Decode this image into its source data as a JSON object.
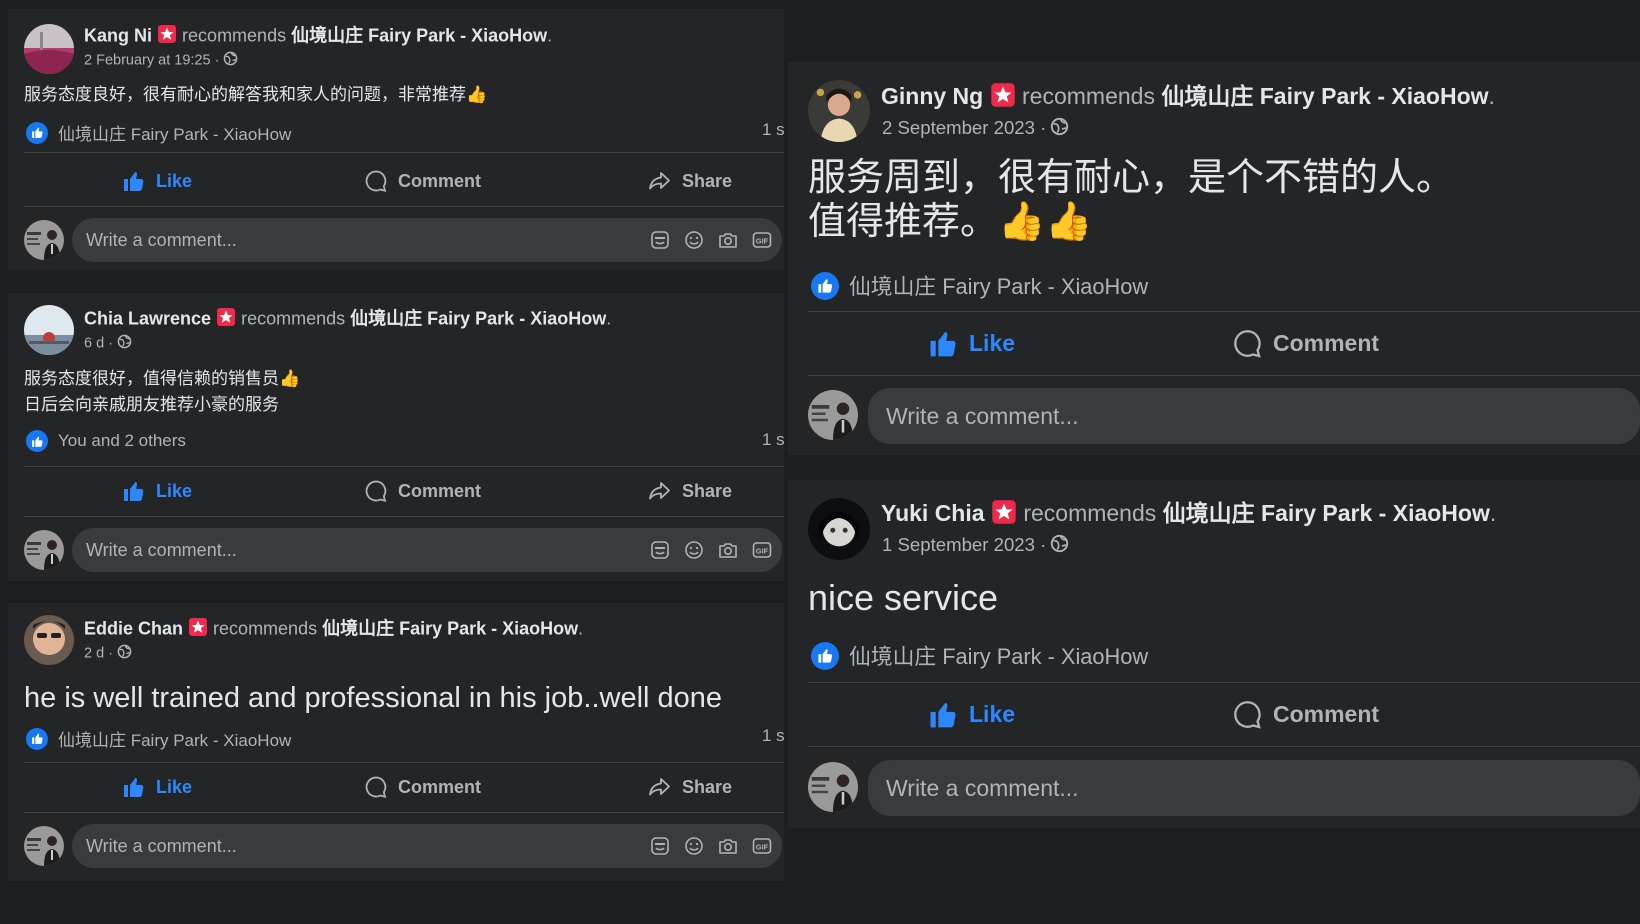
{
  "posts": [
    {
      "author": "Kang Ni",
      "verb": "recommends",
      "page": "仙境山庄 Fairy Park - XiaoHow",
      "period": ".",
      "meta": "2 February at 19:25 ·",
      "text": [
        "服务态度良好，很有耐心的解答我和家人的问题，非常推荐👍"
      ],
      "reaction": "仙境山庄 Fairy Park - XiaoHow",
      "count": "1 s"
    },
    {
      "author": "Chia Lawrence",
      "verb": "recommends",
      "page": "仙境山庄 Fairy Park - XiaoHow",
      "period": ".",
      "meta": "6 d ·",
      "text": [
        "服务态度很好，值得信赖的销售员👍",
        "日后会向亲戚朋友推荐小豪的服务"
      ],
      "reaction": "You and 2 others",
      "count": "1 s"
    },
    {
      "author": "Eddie Chan",
      "verb": "recommends",
      "page": "仙境山庄 Fairy Park - XiaoHow",
      "period": ".",
      "meta": "2 d ·",
      "text": [
        "he is well trained and professional in his job..well done"
      ],
      "reaction": "仙境山庄 Fairy Park - XiaoHow",
      "count": "1 s"
    },
    {
      "author": "Ginny Ng",
      "verb": "recommends",
      "page": "仙境山庄 Fairy Park - XiaoHow",
      "period": ".",
      "meta": "2 September 2023 ·",
      "text": [
        "服务周到，很有耐心，是个不错的人。",
        "值得推荐。👍👍"
      ],
      "reaction": "仙境山庄 Fairy Park - XiaoHow"
    },
    {
      "author": "Yuki Chia",
      "verb": "recommends",
      "page": "仙境山庄 Fairy Park - XiaoHow",
      "period": ".",
      "meta": "1 September 2023 ·",
      "text": [
        "nice service"
      ],
      "reaction": "仙境山庄 Fairy Park - XiaoHow"
    }
  ],
  "actions": {
    "like": "Like",
    "comment": "Comment",
    "share": "Share"
  },
  "comment_placeholder": "Write a comment...",
  "icons": {
    "badge": "recommends-badge-icon",
    "globe": "globe-icon",
    "like": "thumbs-up-icon",
    "comment": "comment-bubble-icon",
    "share": "share-arrow-icon",
    "composer": [
      "sticker-icon",
      "emoji-icon",
      "camera-icon",
      "gif-icon"
    ]
  },
  "colors": {
    "background": "#1c1e21",
    "card": "#242526",
    "text": "#e4e6eb",
    "secondary_text": "#b0b3b8",
    "accent_blue": "#2d88ff",
    "badge_red": "#f02849",
    "input_bg": "#3a3b3c"
  }
}
